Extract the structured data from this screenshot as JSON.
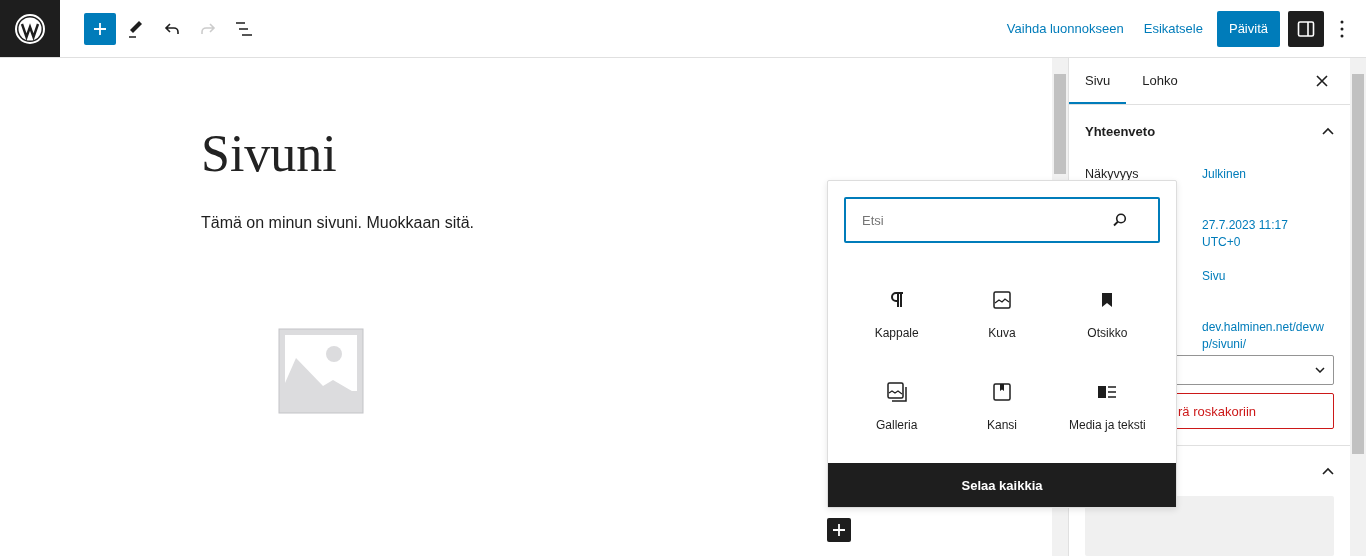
{
  "toolbar": {
    "tools": [
      {
        "kind": "add",
        "disabled": false
      },
      {
        "kind": "edit",
        "disabled": false
      },
      {
        "kind": "undo",
        "disabled": false
      },
      {
        "kind": "redo",
        "disabled": true
      },
      {
        "kind": "outline",
        "disabled": false
      }
    ],
    "links": [
      "Vaihda luonnokseen",
      "Esikatsele"
    ],
    "primary_button": "Päivitä",
    "settings_toggle": {
      "on": true
    }
  },
  "editor": {
    "title": "Sivuni",
    "paragraph": "Tämä on minun sivuni. Muokkaan sitä."
  },
  "sidebar": {
    "tabs": [
      {
        "label": "Sivu",
        "selected": true
      },
      {
        "label": "Lohko",
        "selected": false
      }
    ],
    "summary": {
      "heading": "Yhteenveto",
      "expanded": true,
      "rows": [
        {
          "label": "Näkyvyys",
          "value": "Julkinen"
        },
        {
          "value": "27.7.2023 11:17 UTC+0"
        },
        {
          "value": "Sivu"
        },
        {
          "value": "dev.halminen.net/devwp/sivuni/"
        }
      ],
      "trash_button": "rä roskakoriin"
    },
    "second_section": {
      "expanded": true
    }
  },
  "inserter": {
    "search": {
      "placeholder": "Etsi"
    },
    "blocks": [
      {
        "kind": "paragraph",
        "label": "Kappale"
      },
      {
        "kind": "image",
        "label": "Kuva"
      },
      {
        "kind": "heading",
        "label": "Otsikko"
      },
      {
        "kind": "gallery",
        "label": "Galleria"
      },
      {
        "kind": "cover",
        "label": "Kansi"
      },
      {
        "kind": "media-text",
        "label": "Media ja teksti"
      }
    ],
    "browse_all": "Selaa kaikkia"
  }
}
